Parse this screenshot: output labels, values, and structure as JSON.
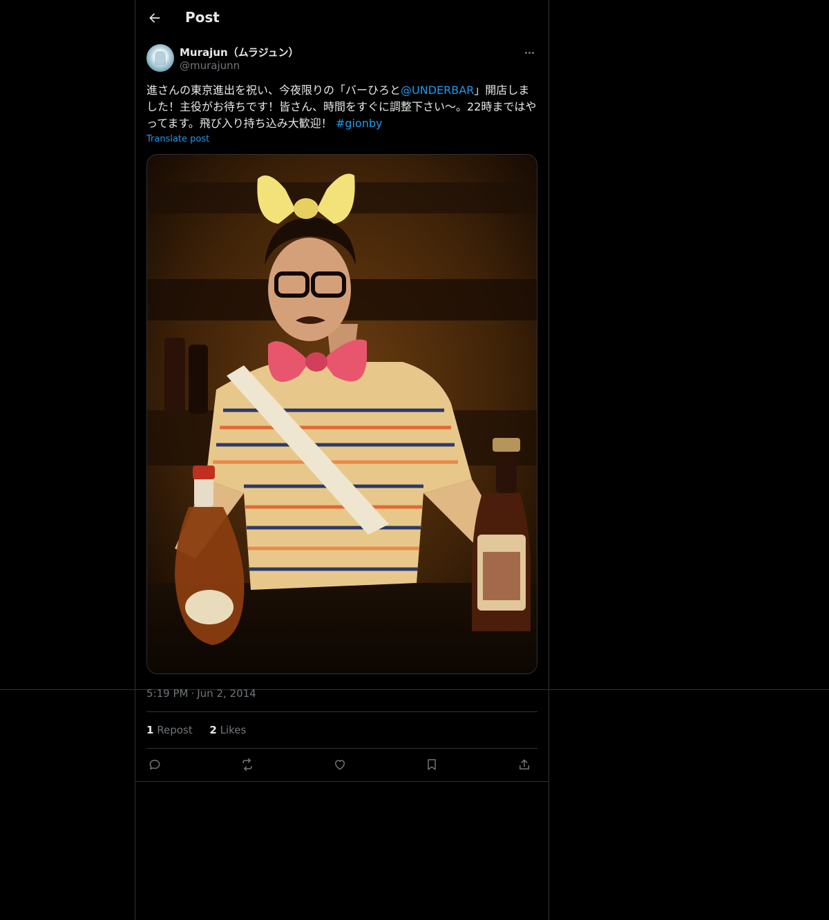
{
  "header": {
    "title": "Post",
    "back_icon": "arrow-left-icon"
  },
  "author": {
    "name": "Murajun（ムラジュン）",
    "handle": "@murajunn",
    "more_icon": "more-horizontal-icon"
  },
  "post": {
    "text_part1": "進さんの東京進出を祝い、今夜限りの「バーひろと",
    "mention": "@UNDERBAR",
    "text_part2": "」開店しました！主役がお待ちです！皆さん、時間をすぐに調整下さい〜。22時まではやってます。飛び入り持ち込み大歓迎！ ",
    "hashtag": "#gionby",
    "translate": "Translate post",
    "timestamp_time": "5:19 PM",
    "timestamp_sep": "·",
    "timestamp_date": "Jun 2, 2014"
  },
  "stats": {
    "reposts_count": "1",
    "reposts_label": "Repost",
    "likes_count": "2",
    "likes_label": "Likes"
  },
  "actions": [
    "reply-icon",
    "repost-icon",
    "like-icon",
    "bookmark-icon",
    "share-icon"
  ],
  "colors": {
    "background": "#000000",
    "text": "#e7e9ea",
    "secondary": "#71767b",
    "accent": "#1d9bf0",
    "border": "#2f3336"
  }
}
